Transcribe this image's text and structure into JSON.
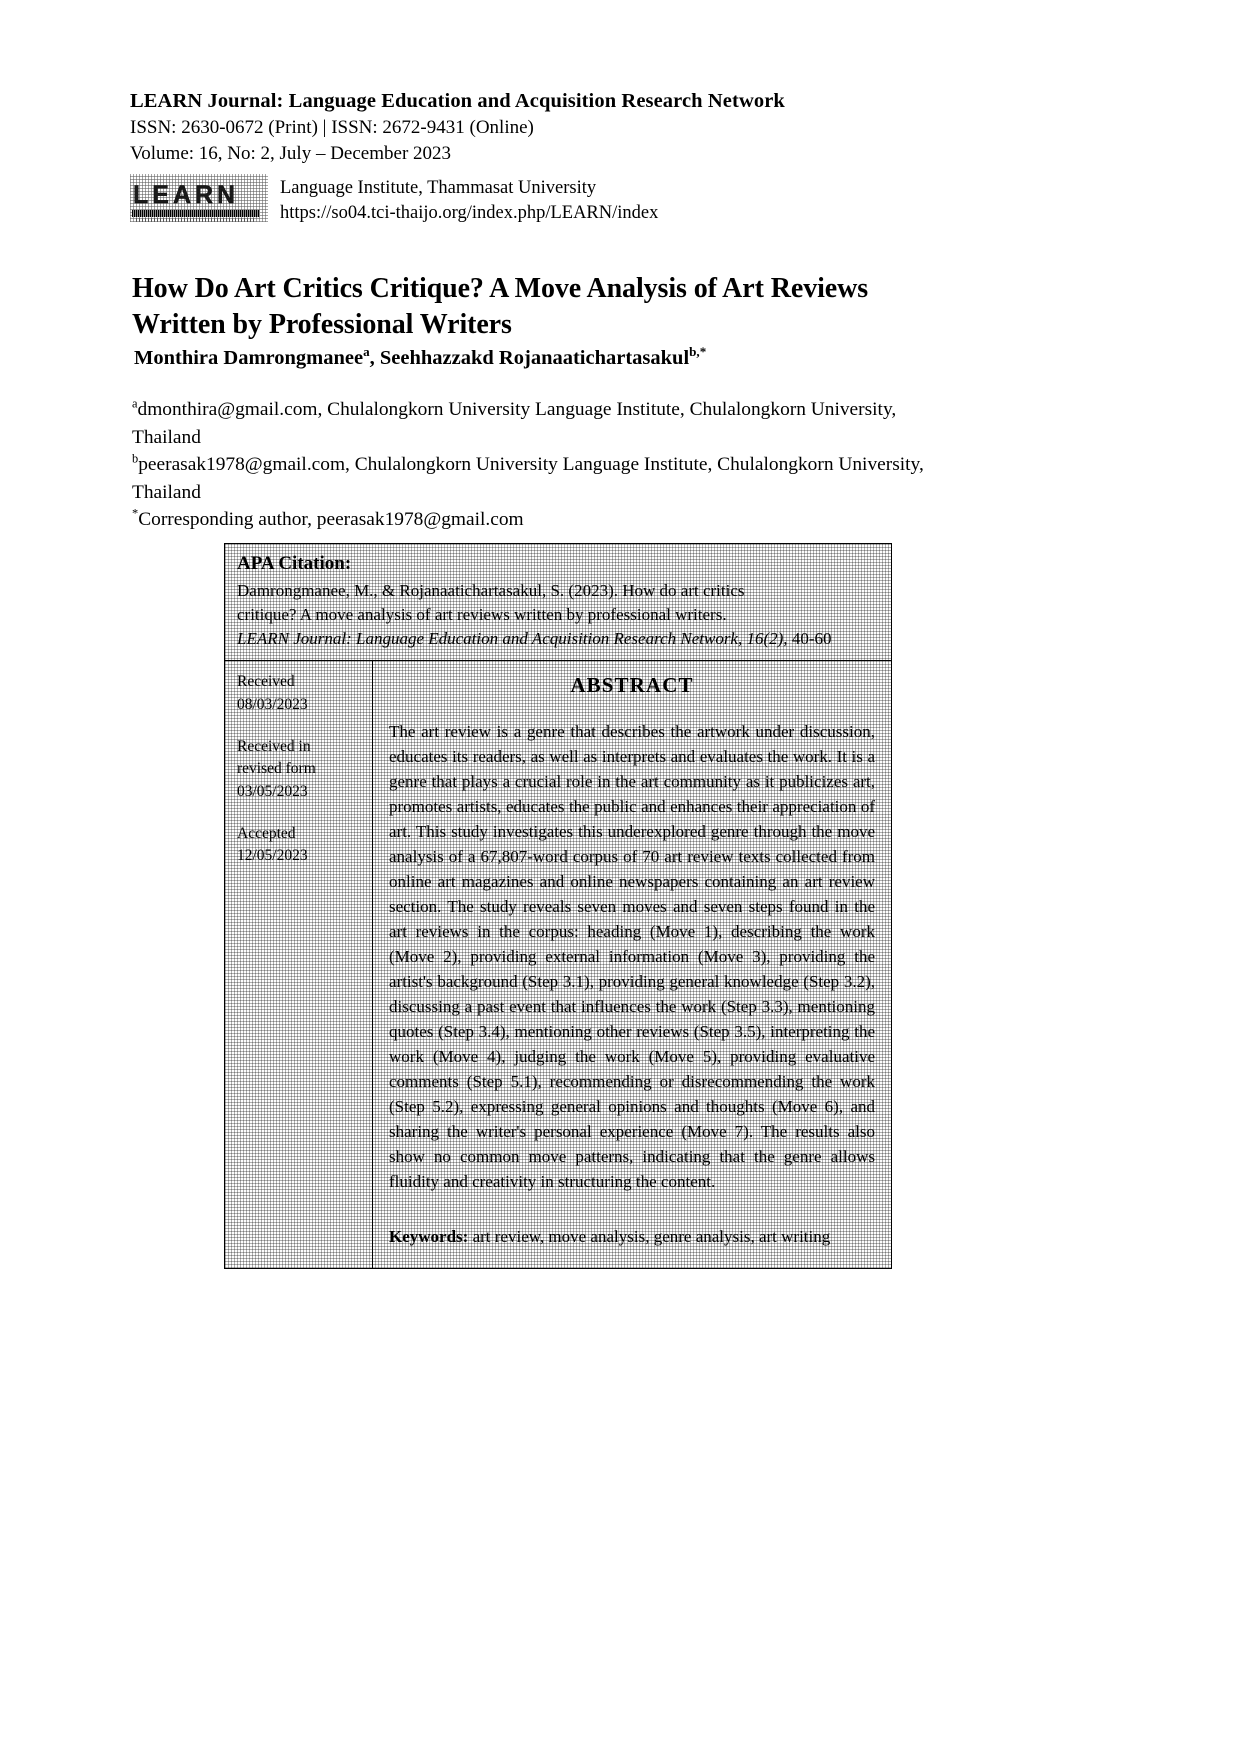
{
  "masthead": {
    "journal_title": "LEARN Journal: Language Education and Acquisition Research Network",
    "issn_line": "ISSN: 2630-0672 (Print) | ISSN: 2672-9431 (Online)",
    "volume_line": "Volume: 16, No: 2, July – December 2023",
    "logo_text": "LEARN",
    "institute": "Language Institute, Thammasat University",
    "url": "https://so04.tci-thaijo.org/index.php/LEARN/index"
  },
  "article": {
    "title": "How Do Art Critics Critique? A Move Analysis of Art Reviews Written by Professional Writers",
    "authors": {
      "author1_name": "Monthira Damrongmanee",
      "author1_marker": "a",
      "separator": ", ",
      "author2_name": "Seehhazzakd Rojanaatichartasakul",
      "author2_marker": "b,*"
    },
    "affiliations": [
      {
        "marker": "a",
        "text": "dmonthira@gmail.com, Chulalongkorn University Language Institute, Chulalongkorn University, Thailand"
      },
      {
        "marker": "b",
        "text": "peerasak1978@gmail.com, Chulalongkorn University Language Institute, Chulalongkorn University, Thailand"
      },
      {
        "marker": "*",
        "text": "Corresponding author, peerasak1978@gmail.com"
      }
    ]
  },
  "apa_citation": {
    "label": "APA Citation:",
    "line1": "Damrongmanee, M., & Rojanaatichartasakul, S. (2023). How do art critics",
    "line2": "critique? A move analysis of art reviews written by professional writers.",
    "line3_italic": "LEARN Journal: Language Education and Acquisition Research Network, 16(2),",
    "line3_tail": " 40-60"
  },
  "dates": [
    {
      "label": "Received",
      "value": "08/03/2023"
    },
    {
      "label_line1": "Received in",
      "label_line2": "revised form",
      "value": "03/05/2023"
    },
    {
      "label": "Accepted",
      "value": "12/05/2023"
    }
  ],
  "abstract": {
    "heading": "ABSTRACT",
    "text": "The art review is a genre that describes the artwork under discussion, educates its readers, as well as interprets and evaluates the work. It is a genre that plays a crucial role in the art community as it publicizes art, promotes artists, educates the public and enhances their appreciation of art. This study investigates this underexplored genre through the move analysis of a 67,807-word corpus of 70 art review texts collected from online art magazines and online newspapers containing an art review section. The study reveals seven moves and seven steps found in the art reviews in the corpus: heading (Move 1), describing the work (Move 2), providing external information (Move 3), providing the artist's background (Step 3.1), providing general knowledge (Step 3.2), discussing a past event that influences the work (Step 3.3), mentioning quotes (Step 3.4), mentioning other reviews (Step 3.5), interpreting the work (Move 4), judging the work (Move 5), providing evaluative comments (Step 5.1), recommending or disrecommending the work (Step 5.2), expressing general opinions and thoughts (Move 6), and sharing the writer's personal experience (Move 7). The results also show no common move patterns, indicating that the genre allows fluidity and creativity in structuring the content.",
    "keywords_label": "Keywords:",
    "keywords_value": " art review, move analysis, genre analysis, art writing"
  }
}
